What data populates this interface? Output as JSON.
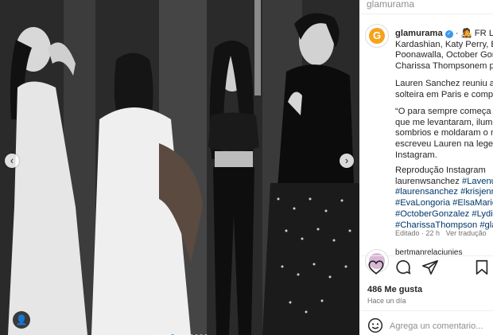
{
  "post": {
    "photo_alt": "",
    "carousel": {
      "dots": 12,
      "active": 4
    },
    "header_text": "glamurama"
  },
  "caption": {
    "username": "glamurama",
    "lines": [
      "· 🧑‍🎤 FR Lauren",
      "Kardashian, Katy Perry, Eva L",
      "Poonawalla, October Gonzale",
      "Charissa Thompsonem para"
    ],
    "para2": [
      "Lauren Sanchez reuniu algun",
      "solteira em Paris e compartil"
    ],
    "para3": [
      "“O para sempre começa com",
      "que me levantaram, iluminar",
      "sombrios e moldaram o meu",
      "escreveu Lauren na legenda",
      "Instagram."
    ],
    "repro": [
      "Reprodução Instagram",
      "laurenwsanchez"
    ],
    "tags": [
      "#Lavenue",
      "#laurensanchez #krisjenner #",
      "#EvaLongoria #ElsaMarieCol",
      "#OctoberGonzalez #LydiaKiv",
      "#CharissaThompson #glamu"
    ],
    "edited": "Editado · 22 h",
    "translate": "Ver tradução"
  },
  "comment_preview": "bertmanrelaciunies",
  "likes": "486 Me gusta",
  "posted": "Hace un día",
  "add_comment_placeholder": "Agrega un comentario..."
}
